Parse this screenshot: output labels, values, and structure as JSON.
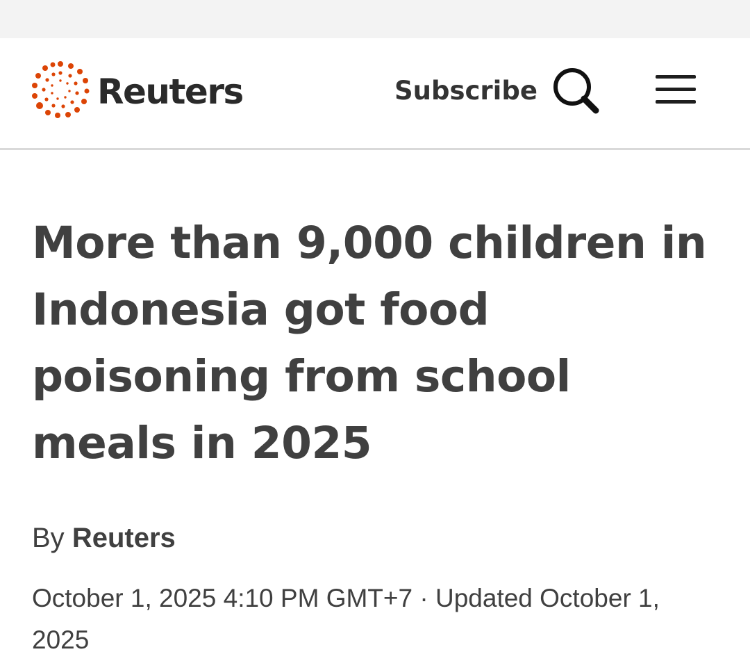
{
  "header": {
    "brand": "Reuters",
    "subscribe_label": "Subscribe",
    "logo_icon": "reuters-dot-ring-logo",
    "search_icon": "search-icon",
    "menu_icon": "hamburger-menu-icon",
    "accent_color": "#dc4405"
  },
  "article": {
    "headline": "More than 9,000 children in Indonesia got food poisoning from school meals in 2025",
    "byline_prefix": "By",
    "byline_author": "Reuters",
    "published": "October 1, 2025 4:10 PM GMT+7",
    "separator": "·",
    "updated_label": "Updated",
    "updated": "October 1, 2025"
  }
}
